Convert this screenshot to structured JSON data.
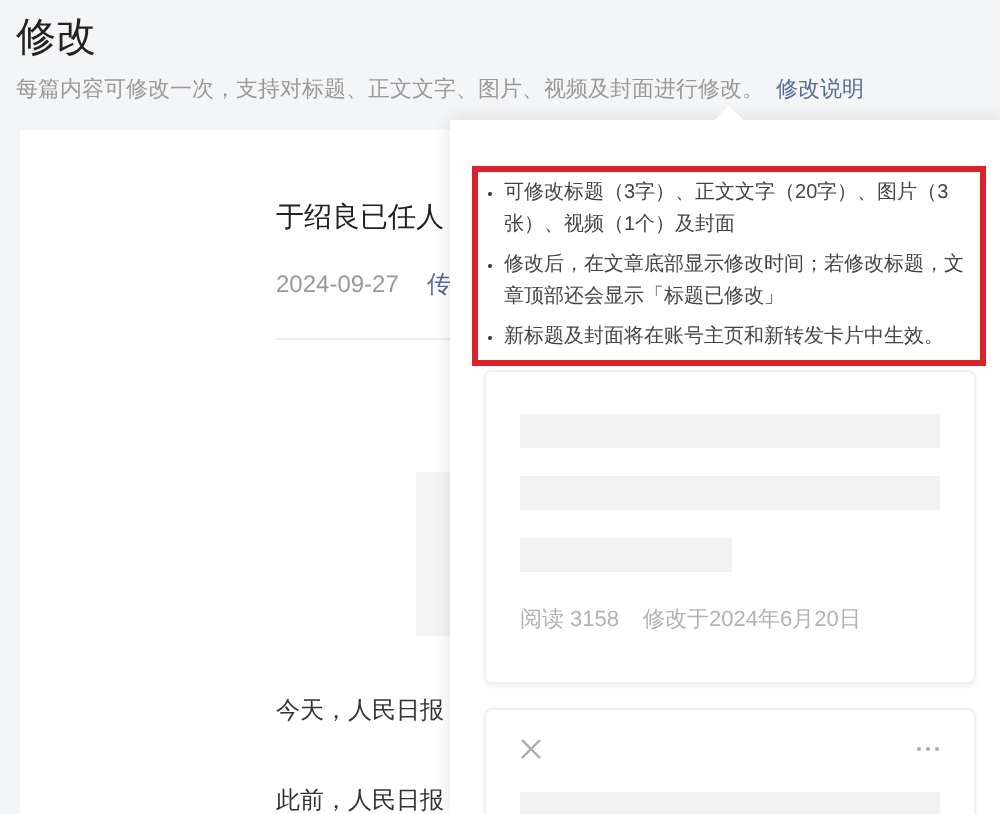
{
  "page": {
    "title": "修改",
    "subtitle": "每篇内容可修改一次，支持对标题、正文文字、图片、视频及封面进行修改。",
    "help_link": "修改说明"
  },
  "article": {
    "title": "于绍良已任人",
    "date": "2024-09-27",
    "meta_link": "传",
    "paragraphs": [
      "今天，人民日报",
      "此前，人民日报"
    ]
  },
  "popover": {
    "notes": [
      "可修改标题（3字）、正文文字（20字）、图片（3张）、视频（1个）及封面",
      "修改后，在文章底部显示修改时间；若修改标题，文章顶部还会显示「标题已修改」",
      "新标题及封面将在账号主页和新转发卡片中生效。"
    ],
    "cards": [
      {
        "kind": "stats",
        "reads": "阅读 3158",
        "modified": "修改于2024年6月20日"
      },
      {
        "kind": "actions"
      }
    ]
  }
}
